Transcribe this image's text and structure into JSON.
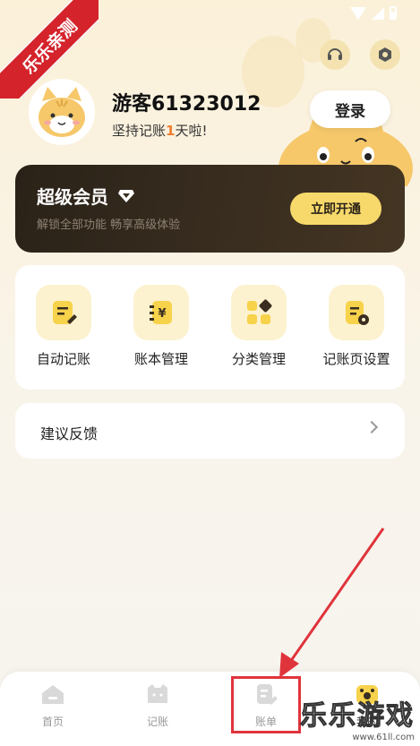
{
  "watermark": {
    "corner_text": "乐乐亲测",
    "brand_text": "乐乐游戏",
    "site_text": "www.61ll.com"
  },
  "profile": {
    "username": "游客61323012",
    "streak_prefix": "坚持记账",
    "streak_days": "1",
    "streak_suffix": "天啦!",
    "login_label": "登录"
  },
  "header": {
    "support_icon": "headset-icon",
    "settings_icon": "hexagon-settings-icon"
  },
  "vip": {
    "title": "超级会员",
    "subtitle": "解锁全部功能 畅享高级体验",
    "button_label": "立即开通"
  },
  "features": [
    {
      "label": "自动记账",
      "icon": "auto-record-icon"
    },
    {
      "label": "账本管理",
      "icon": "ledger-icon"
    },
    {
      "label": "分类管理",
      "icon": "category-icon"
    },
    {
      "label": "记账页设置",
      "icon": "record-settings-icon"
    }
  ],
  "feedback": {
    "label": "建议反馈"
  },
  "tabs": [
    {
      "label": "首页",
      "icon": "home-icon"
    },
    {
      "label": "记账",
      "icon": "record-icon"
    },
    {
      "label": "账单",
      "icon": "bill-icon"
    },
    {
      "label": "我的",
      "icon": "mine-icon"
    }
  ],
  "colors": {
    "accent": "#f7d96b",
    "vip_bg": "#2a2218",
    "annotation_red": "#e0343c",
    "streak_highlight": "#f07d2d"
  }
}
